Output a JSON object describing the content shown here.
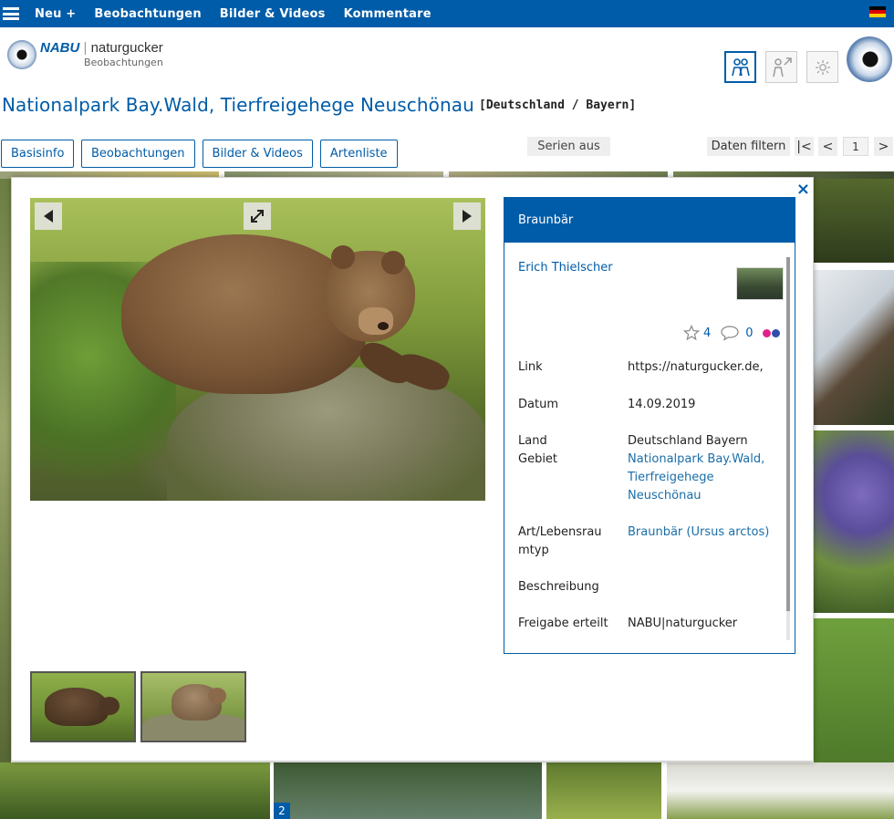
{
  "topbar": {
    "menu_items": [
      "Neu +",
      "Beobachtungen",
      "Bilder & Videos",
      "Kommentare"
    ]
  },
  "header": {
    "logo_brand": "NABU",
    "logo_name": "naturgucker",
    "logo_sub": "Beobachtungen"
  },
  "page": {
    "title": "Nationalpark Bay.Wald, Tierfreigehege Neuschönau",
    "region": "[Deutschland / Bayern]"
  },
  "tabs": [
    "Basisinfo",
    "Beobachtungen",
    "Bilder & Videos",
    "Artenliste"
  ],
  "toolbar": {
    "series_label": "Serien aus",
    "filter_label": "Daten filtern",
    "first_label": "|<",
    "prev_label": "<",
    "page_number": "1",
    "next_label": ">"
  },
  "modal": {
    "close_label": "×",
    "species_header": "Braunbär",
    "author": "Erich Thielscher",
    "stars": "4",
    "comments": "0",
    "fields": {
      "link_label": "Link",
      "link_value": "https://naturgucker.de,",
      "date_label": "Datum",
      "date_value": "14.09.2019",
      "country_label": "Land",
      "country_value": "Deutschland Bayern",
      "area_label": "Gebiet",
      "area_value": "Nationalpark Bay.Wald, Tierfreigehege Neuschönau",
      "species_label": "Art/Lebensraumtyp",
      "species_value": "Braunbär (Ursus arctos)",
      "desc_label": "Beschreibung",
      "release_label": "Freigabe erteilt",
      "release_value": "NABU|naturgucker"
    }
  },
  "gallery": {
    "page_badge": "2"
  },
  "colors": {
    "brand_blue": "#005ca8",
    "link_blue": "#1a6ea8",
    "dot_pink": "#e0218a",
    "dot_blue": "#2f4fa8"
  }
}
